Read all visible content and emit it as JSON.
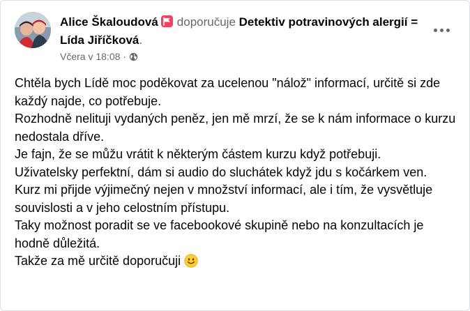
{
  "post": {
    "author": "Alice Škaloudová",
    "recommends_verb": "doporučuje",
    "page_name": "Detektiv potravinových alergií = Lída Jiříčková",
    "page_name_suffix": ".",
    "timestamp": "Včera v 18:08",
    "meta_separator": "·",
    "icons": {
      "recommend": "recommend-flag-icon",
      "audience": "globe-icon",
      "more": "more-options-icon",
      "emoji": "smiling-face-emoji"
    },
    "colors": {
      "badge": "#f3425f",
      "secondary_text": "#65676b",
      "primary_text": "#050505"
    },
    "paragraphs": [
      "Chtěla bych Lídě moc poděkovat za ucelenou \"nálož\" informací, určitě si zde každý najde, co potřebuje.",
      "Rozhodně nelituji vydaných peněz, jen mě mrzí, že se k nám informace o kurzu nedostala dříve.",
      "Je fajn, že se můžu vrátit k některým částem kurzu když potřebuji.",
      "Uživatelsky perfektní, dám si audio do sluchátek když jdu s kočárkem ven.",
      "Kurz mi přijde výjimečný nejen v množství informací, ale i tím, že vysvětluje souvislosti a v jeho celostním přístupu.",
      "Taky možnost poradit se ve facebookové skupině nebo na konzultacích je hodně důležitá.",
      "Takže za mě určitě doporučuji"
    ]
  }
}
